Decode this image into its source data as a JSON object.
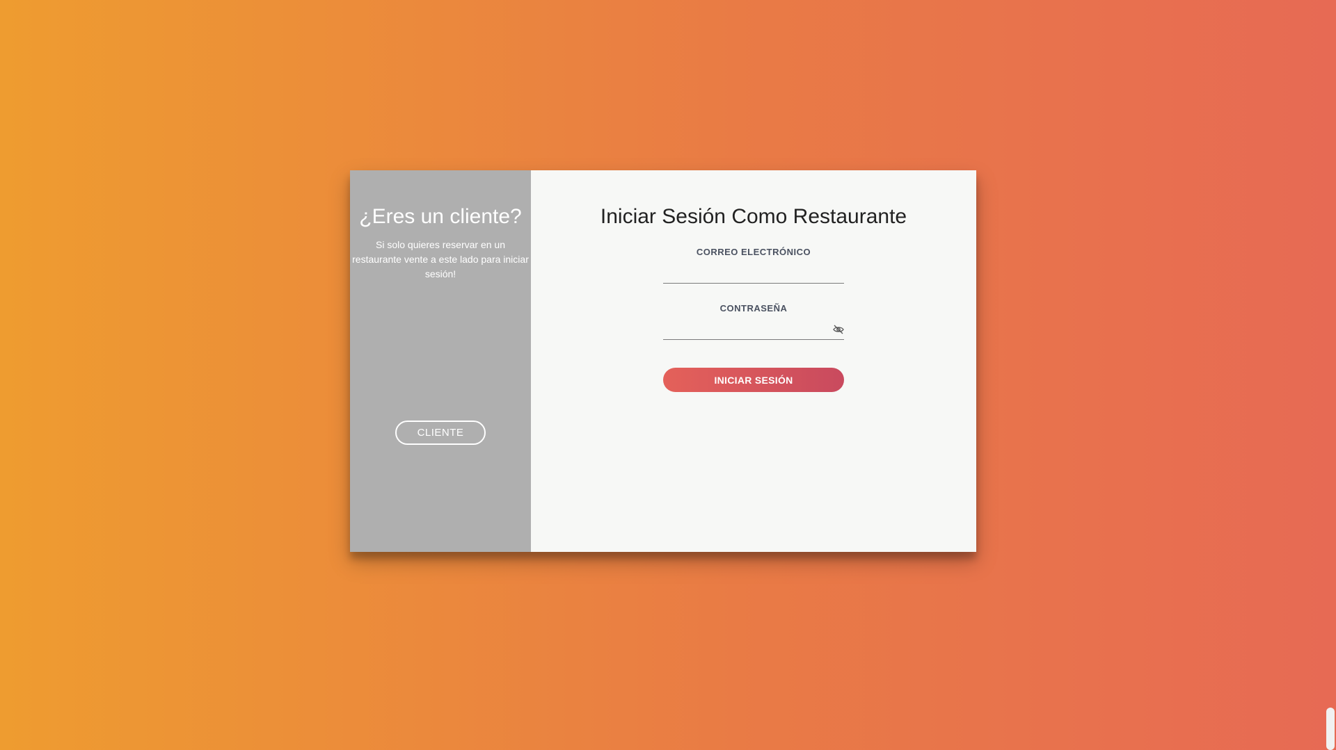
{
  "left_panel": {
    "title": "¿Eres un cliente?",
    "text": "Si solo quieres reservar en un restaurante vente a este lado para iniciar sesión!",
    "button_label": "CLIENTE"
  },
  "right_panel": {
    "title": "Iniciar Sesión Como Restaurante",
    "email": {
      "label": "CORREO ELECTRÓNICO",
      "value": ""
    },
    "password": {
      "label": "CONTRASEÑA",
      "value": "",
      "toggle_icon": "eye-slash-icon"
    },
    "submit_label": "INICIAR SESIÓN"
  },
  "colors": {
    "background_start": "#ee9c30",
    "background_end": "#e76a54",
    "left_panel_bg": "#afafaf",
    "right_panel_bg": "#f7f8f6",
    "button_start": "#e4615a",
    "button_end": "#c94a5e"
  }
}
